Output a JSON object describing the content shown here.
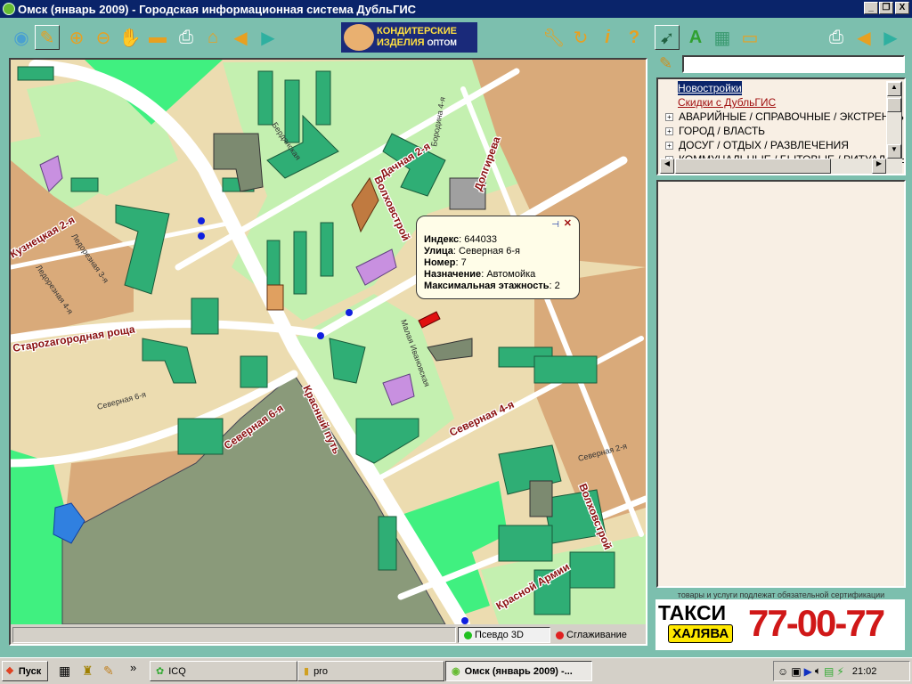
{
  "window": {
    "title": "Омск (январь 2009) - Городская информационная система ДубльГИС",
    "minimize": "_",
    "maximize": "❐",
    "close": "X"
  },
  "toolbar": {
    "left_tools": [
      "globe",
      "pointer",
      "zoom-in",
      "zoom-out",
      "hand",
      "ruler",
      "print",
      "home",
      "back",
      "forward"
    ],
    "banner": {
      "line1": "КОНДИТЕРСКИЕ",
      "line2": "ИЗДЕЛИЯ",
      "line3": "ОПТОМ"
    },
    "right_tools": [
      "wrench",
      "refresh",
      "info",
      "help"
    ],
    "panel_tools": [
      "navigator",
      "search-abc",
      "money",
      "bus"
    ],
    "panel_nav": [
      "print",
      "back",
      "forward"
    ]
  },
  "map": {
    "streets": [
      "Дачная 2-я",
      "Долгирева",
      "Волховстрой",
      "Староzагородная роща",
      "Северная 6-я",
      "Красный путь",
      "Северная 4-я",
      "Волховстрой",
      "Северная 2-я",
      "Ледорезная 3-я",
      "Ледорезная 4-я",
      "Бердянская",
      "Малая Ивановская",
      "Красной Армии",
      "Бородина 4-я",
      "Северная 6-я",
      "Кузнецкая 2-я"
    ],
    "popup": {
      "index_label": "Индекс",
      "index_value": "644033",
      "street_label": "Улица",
      "street_value": "Северная 6-я",
      "number_label": "Номер",
      "number_value": "7",
      "purpose_label": "Назначение",
      "purpose_value": "Автомойка",
      "floors_label": "Максимальная этажность",
      "floors_value": "2"
    }
  },
  "statusbar": {
    "text": "",
    "pseudo3d": "Псевдо 3D",
    "smoothing": "Сглаживание",
    "pseudo3d_color": "#20c020",
    "smoothing_color": "#e02020"
  },
  "search": {
    "value": ""
  },
  "tree": {
    "items": [
      {
        "label": "Новостройки",
        "selected": true
      },
      {
        "label": "Скидки с ДубльГИС"
      },
      {
        "label": "АВАРИЙНЫЕ / СПРАВОЧНЫЕ / ЭКСТРЕННЫЕ"
      },
      {
        "label": "ГОРОД / ВЛАСТЬ"
      },
      {
        "label": "ДОСУГ / ОТДЫХ / РАЗВЛЕЧЕНИЯ"
      },
      {
        "label": "КОММУНАЛЬНЫЕ / БЫТОВЫЕ / РИТУАЛЬНЫЕ"
      }
    ]
  },
  "ad": {
    "cert": "товары и услуги подлежат обязательной сертификации",
    "taxi": "ТАКСИ",
    "brand": "ХАЛЯВА",
    "phone": "77-00-77"
  },
  "taskbar": {
    "start": "Пуск",
    "chevron": "»",
    "tasks": [
      "ICQ",
      "pro",
      "Омск (январь 2009) -..."
    ],
    "clock": "21:02"
  }
}
